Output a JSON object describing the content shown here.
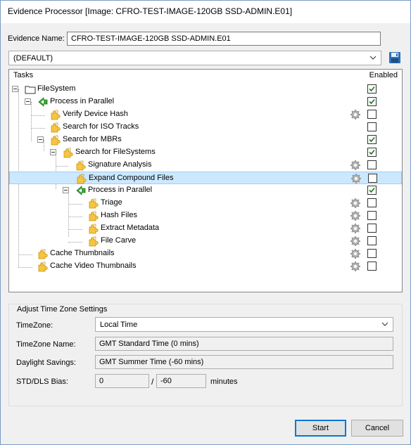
{
  "window": {
    "title": "Evidence Processor [Image: CFRO-TEST-IMAGE-120GB SSD-ADMIN.E01]"
  },
  "evidence": {
    "label": "Evidence Name:",
    "value": "CFRO-TEST-IMAGE-120GB SSD-ADMIN.E01"
  },
  "profile": {
    "selected": "(DEFAULT)"
  },
  "tasks": {
    "header": "Tasks",
    "enabled_header": "Enabled",
    "items": [
      {
        "label": "FileSystem",
        "checked": true,
        "gear": false
      },
      {
        "label": "Process in Parallel",
        "checked": true,
        "gear": false
      },
      {
        "label": "Verify Device Hash",
        "checked": false,
        "gear": true
      },
      {
        "label": "Search for ISO Tracks",
        "checked": false,
        "gear": false
      },
      {
        "label": "Search for MBRs",
        "checked": true,
        "gear": false
      },
      {
        "label": "Search for FileSystems",
        "checked": true,
        "gear": false
      },
      {
        "label": "Signature Analysis",
        "checked": false,
        "gear": true
      },
      {
        "label": "Expand Compound Files",
        "checked": false,
        "gear": true
      },
      {
        "label": "Process in Parallel",
        "checked": true,
        "gear": false
      },
      {
        "label": "Triage",
        "checked": false,
        "gear": true
      },
      {
        "label": "Hash Files",
        "checked": false,
        "gear": true
      },
      {
        "label": "Extract Metadata",
        "checked": false,
        "gear": true
      },
      {
        "label": "File Carve",
        "checked": false,
        "gear": true
      },
      {
        "label": "Cache Thumbnails",
        "checked": false,
        "gear": true
      },
      {
        "label": "Cache Video Thumbnails",
        "checked": false,
        "gear": true
      }
    ]
  },
  "timezone": {
    "group_title": "Adjust Time Zone Settings",
    "tz_label": "TimeZone:",
    "tz_value": "Local Time",
    "tzname_label": "TimeZone Name:",
    "tzname_value": "GMT Standard Time (0 mins)",
    "dst_label": "Daylight Savings:",
    "dst_value": "GMT Summer Time (-60 mins)",
    "bias_label": "STD/DLS Bias:",
    "std_bias": "0",
    "separator": "/",
    "dls_bias": "-60",
    "unit": "minutes"
  },
  "buttons": {
    "start": "Start",
    "cancel": "Cancel"
  },
  "icons": {
    "folder": "folder-icon",
    "parallel": "parallel-process-icon",
    "puzzle": "puzzle-piece-icon",
    "gear": "gear-icon",
    "save": "save-icon",
    "chevron": "chevron-down-icon"
  },
  "colors": {
    "selection": "#cce8ff",
    "accent": "#0078d7"
  }
}
